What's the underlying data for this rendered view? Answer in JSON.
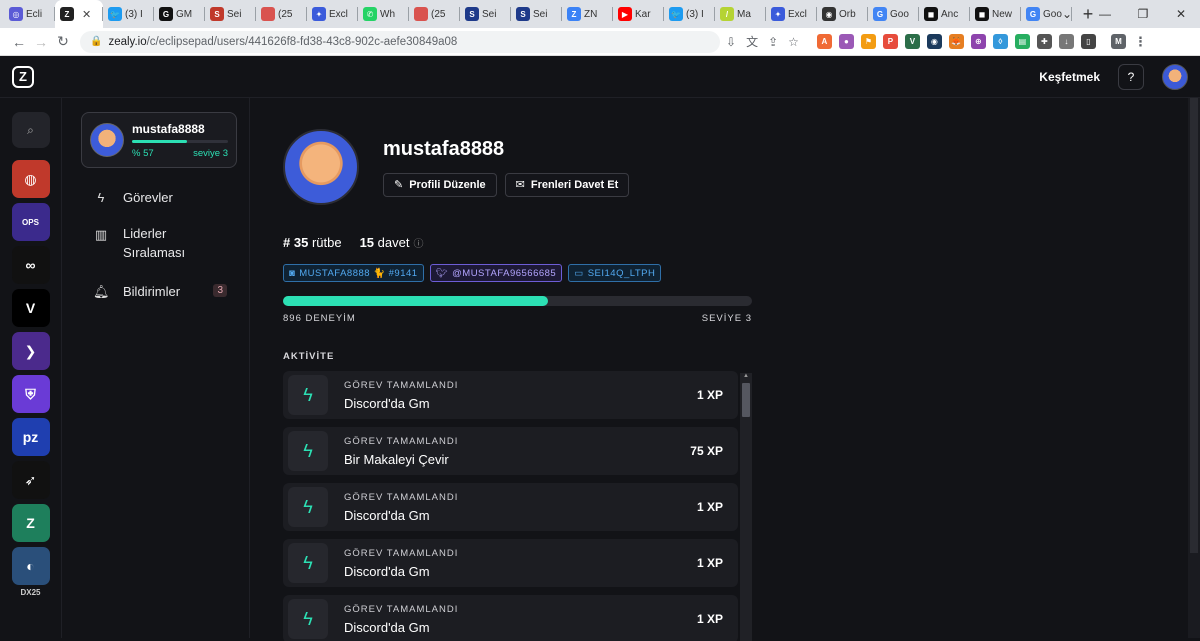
{
  "browser": {
    "tabs": [
      {
        "label": "Ecli",
        "color": "#5b5bd6",
        "glyph": "◎"
      },
      {
        "label": "",
        "color": "#222",
        "glyph": "Z",
        "active": true
      },
      {
        "label": "(3) I",
        "color": "#1d9bf0",
        "glyph": "🐦"
      },
      {
        "label": "GM",
        "color": "#111",
        "glyph": "G"
      },
      {
        "label": "Sei",
        "color": "#c0392b",
        "glyph": "S"
      },
      {
        "label": "(25",
        "color": "#d9534f",
        "glyph": "257"
      },
      {
        "label": "Excl",
        "color": "#3b5bdb",
        "glyph": "✦"
      },
      {
        "label": "Wh",
        "color": "#25d366",
        "glyph": "✆"
      },
      {
        "label": "(25",
        "color": "#d9534f",
        "glyph": "256"
      },
      {
        "label": "Sei",
        "color": "#1e3a8a",
        "glyph": "S"
      },
      {
        "label": "Sei",
        "color": "#1e3a8a",
        "glyph": "S"
      },
      {
        "label": "ZN",
        "color": "#3b82f6",
        "glyph": "Z"
      },
      {
        "label": "Kar",
        "color": "#ff0000",
        "glyph": "▶"
      },
      {
        "label": "(3) I",
        "color": "#1d9bf0",
        "glyph": "🐦"
      },
      {
        "label": "Ma",
        "color": "#b5d334",
        "glyph": "/"
      },
      {
        "label": "Excl",
        "color": "#3b5bdb",
        "glyph": "✦"
      },
      {
        "label": "Orb",
        "color": "#333",
        "glyph": "◉"
      },
      {
        "label": "Goo",
        "color": "#4285f4",
        "glyph": "G"
      },
      {
        "label": "Anc",
        "color": "#111",
        "glyph": "◼"
      },
      {
        "label": "New",
        "color": "#111",
        "glyph": "◼"
      },
      {
        "label": "Goo",
        "color": "#4285f4",
        "glyph": "G"
      }
    ],
    "url_host": "zealy.io",
    "url_path": "/c/eclipsepad/users/441626f8-fd38-43c8-902c-aefe30849a08",
    "profile_initial": "M"
  },
  "topnav": {
    "explore": "Keşfetmek",
    "help": "?"
  },
  "communities": [
    {
      "name": "red-swirl",
      "color": "#c0392b",
      "glyph": "◍"
    },
    {
      "name": "ops",
      "color": "#3b2a8c",
      "glyph": "OPS"
    },
    {
      "name": "infinity",
      "color": "#111",
      "glyph": "∞"
    },
    {
      "name": "v-logo",
      "color": "#000",
      "glyph": "V"
    },
    {
      "name": "arrow",
      "color": "#4b2a8c",
      "glyph": "❯"
    },
    {
      "name": "shield",
      "color": "#6a3bd6",
      "glyph": "⛨"
    },
    {
      "name": "planet-zealy",
      "color": "#1f3fb0",
      "glyph": "pz"
    },
    {
      "name": "bird",
      "color": "#111",
      "glyph": "➶"
    },
    {
      "name": "z-green",
      "color": "#1e7f5c",
      "glyph": "Z"
    },
    {
      "name": "dolphin",
      "color": "#2a4f7a",
      "glyph": "◐"
    }
  ],
  "communities_footer": "DX25",
  "sidebar": {
    "username": "mustafa8888",
    "percent_label": "% 57",
    "percent": 57,
    "level_label": "seviye 3",
    "items": [
      {
        "label": "Görevler",
        "icon": "⚡"
      },
      {
        "label": "Liderler Sıralaması",
        "icon": "▮▮"
      },
      {
        "label": "Bildirimler",
        "icon": "🔔",
        "badge": "3"
      }
    ]
  },
  "profile": {
    "username": "mustafa8888",
    "edit_button": "Profili Düzenle",
    "invite_button": "Frenleri Davet Et",
    "rank_number": "# 35",
    "rank_label": "rütbe",
    "invite_count": "15",
    "invite_label": "davet",
    "discord": "MUSTAFA8888 🐈 #9141",
    "twitter": "@MUSTAFA96566685",
    "wallet": "SEI14Q_LTPH",
    "xp_label": "896 DENEYİM",
    "level_label": "SEVİYE 3",
    "xp_progress": 0.565
  },
  "activity": {
    "header": "AKTİVİTE",
    "items": [
      {
        "label": "GÖREV TAMAMLANDI",
        "title": "Discord'da Gm",
        "xp": "1 XP"
      },
      {
        "label": "GÖREV TAMAMLANDI",
        "title": "Bir Makaleyi Çevir",
        "xp": "75 XP"
      },
      {
        "label": "GÖREV TAMAMLANDI",
        "title": "Discord'da Gm",
        "xp": "1 XP"
      },
      {
        "label": "GÖREV TAMAMLANDI",
        "title": "Discord'da Gm",
        "xp": "1 XP"
      },
      {
        "label": "GÖREV TAMAMLANDI",
        "title": "Discord'da Gm",
        "xp": "1 XP"
      }
    ]
  }
}
